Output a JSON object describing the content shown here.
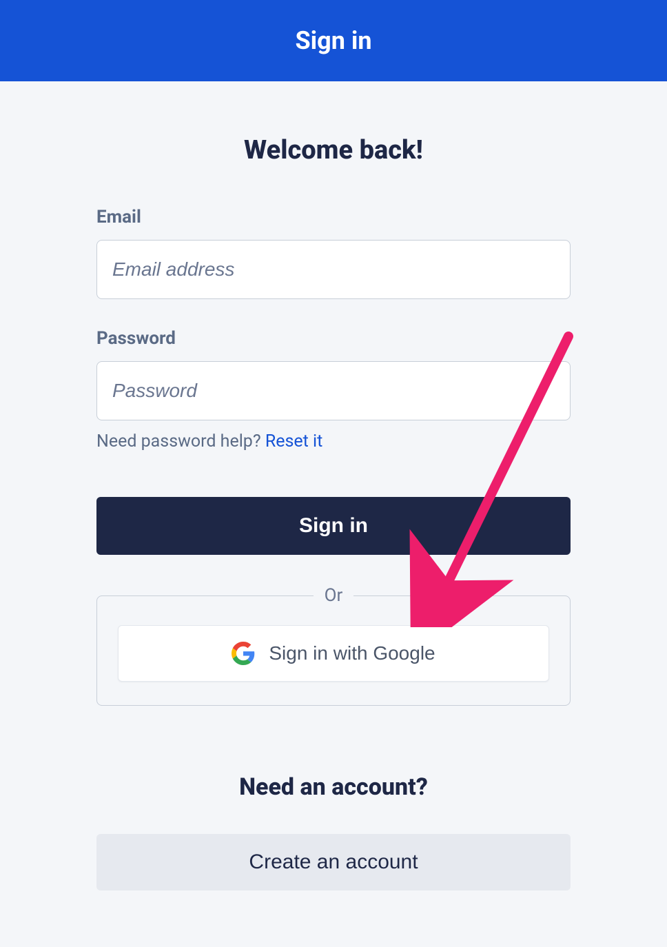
{
  "header": {
    "title": "Sign in"
  },
  "main": {
    "welcome_title": "Welcome back!",
    "email": {
      "label": "Email",
      "placeholder": "Email address",
      "value": ""
    },
    "password": {
      "label": "Password",
      "placeholder": "Password",
      "value": ""
    },
    "help": {
      "text": "Need password help? ",
      "link_text": "Reset it"
    },
    "signin_button": "Sign in",
    "or_label": "Or",
    "google_button": "Sign in with Google",
    "need_account_title": "Need an account?",
    "create_button": "Create an account"
  },
  "annotation": {
    "arrow_color": "#ed1e6b"
  }
}
